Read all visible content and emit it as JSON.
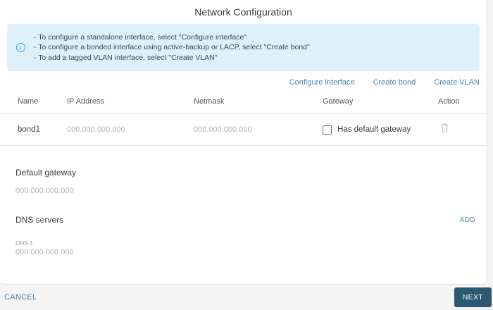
{
  "dialog": {
    "title": "Network Configuration",
    "info_box": {
      "icon_glyph": "i",
      "lines": [
        "- To configure a standalone interface, select \"Configure interface\"",
        "- To configure a bonded interface using active-backup or LACP, select \"Create bond\"",
        "- To add a tagged VLAN interface, select \"Create VLAN\""
      ]
    },
    "actions": {
      "configure_interface": "Configure interface",
      "create_bond": "Create bond",
      "create_vlan": "Create VLAN"
    },
    "table": {
      "headers": [
        "Name",
        "IP Address",
        "Netmask",
        "Gateway",
        "Action"
      ],
      "rows": [
        {
          "name": "bond1",
          "ip_placeholder": "000.000.000.000",
          "netmask_placeholder": "000.000.000.000",
          "gateway_checkbox_label": "Has default gateway",
          "gateway_checked": false,
          "action_icon": "trash-icon"
        }
      ]
    },
    "default_gateway": {
      "label": "Default gateway",
      "placeholder": "000.000.000.000"
    },
    "dns": {
      "label": "DNS servers",
      "add_label": "ADD",
      "fields": [
        {
          "label": "DNS 1",
          "placeholder": "000.000.000.000"
        }
      ]
    }
  },
  "footer": {
    "cancel_label": "CANCEL",
    "next_label": "NEXT"
  },
  "colors": {
    "link_blue": "#4585b5",
    "info_box_bg": "#def1fa",
    "info_icon_blue": "#29aae1",
    "focused_underline": "#4a7fa5",
    "next_button_bg": "#2c5871"
  }
}
